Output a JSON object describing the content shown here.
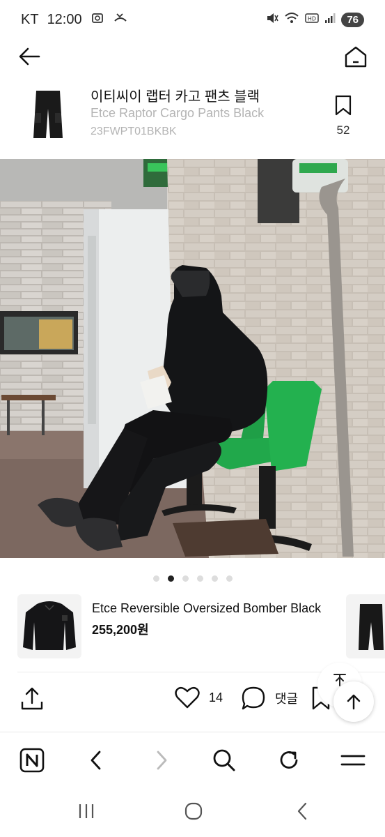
{
  "status_bar": {
    "carrier": "KT",
    "time": "12:00",
    "battery": "76",
    "icons": [
      "screenshot-icon",
      "call-missed-icon",
      "mute-icon",
      "wifi-icon",
      "hd-icon",
      "signal-icon"
    ]
  },
  "header": {
    "back_icon": "arrow-left-icon",
    "home_icon": "home-icon"
  },
  "product": {
    "title_ko": "이티씨이 랩터 카고 팬츠 블랙",
    "title_en": "Etce Raptor Cargo Pants Black",
    "code": "23FWPT01BKBK",
    "bookmark_count": "52"
  },
  "gallery": {
    "dot_count": 6,
    "active_index": 1
  },
  "related_product": {
    "name": "Etce Reversible Oversized Bomber Black",
    "price": "255,200원"
  },
  "actions": {
    "like_count": "14",
    "comment_label": "댓글"
  },
  "browser_bar": {
    "icons": [
      "naver-n-icon",
      "back-icon",
      "forward-icon",
      "search-icon",
      "refresh-icon",
      "menu-icon"
    ]
  },
  "android_nav": {
    "icons": [
      "recents-icon",
      "home-circle-icon",
      "back-chevron-icon"
    ]
  },
  "colors": {
    "seat_green": "#1fa64a",
    "muted_text": "#b4b4b4",
    "battery_bg": "#444444"
  }
}
